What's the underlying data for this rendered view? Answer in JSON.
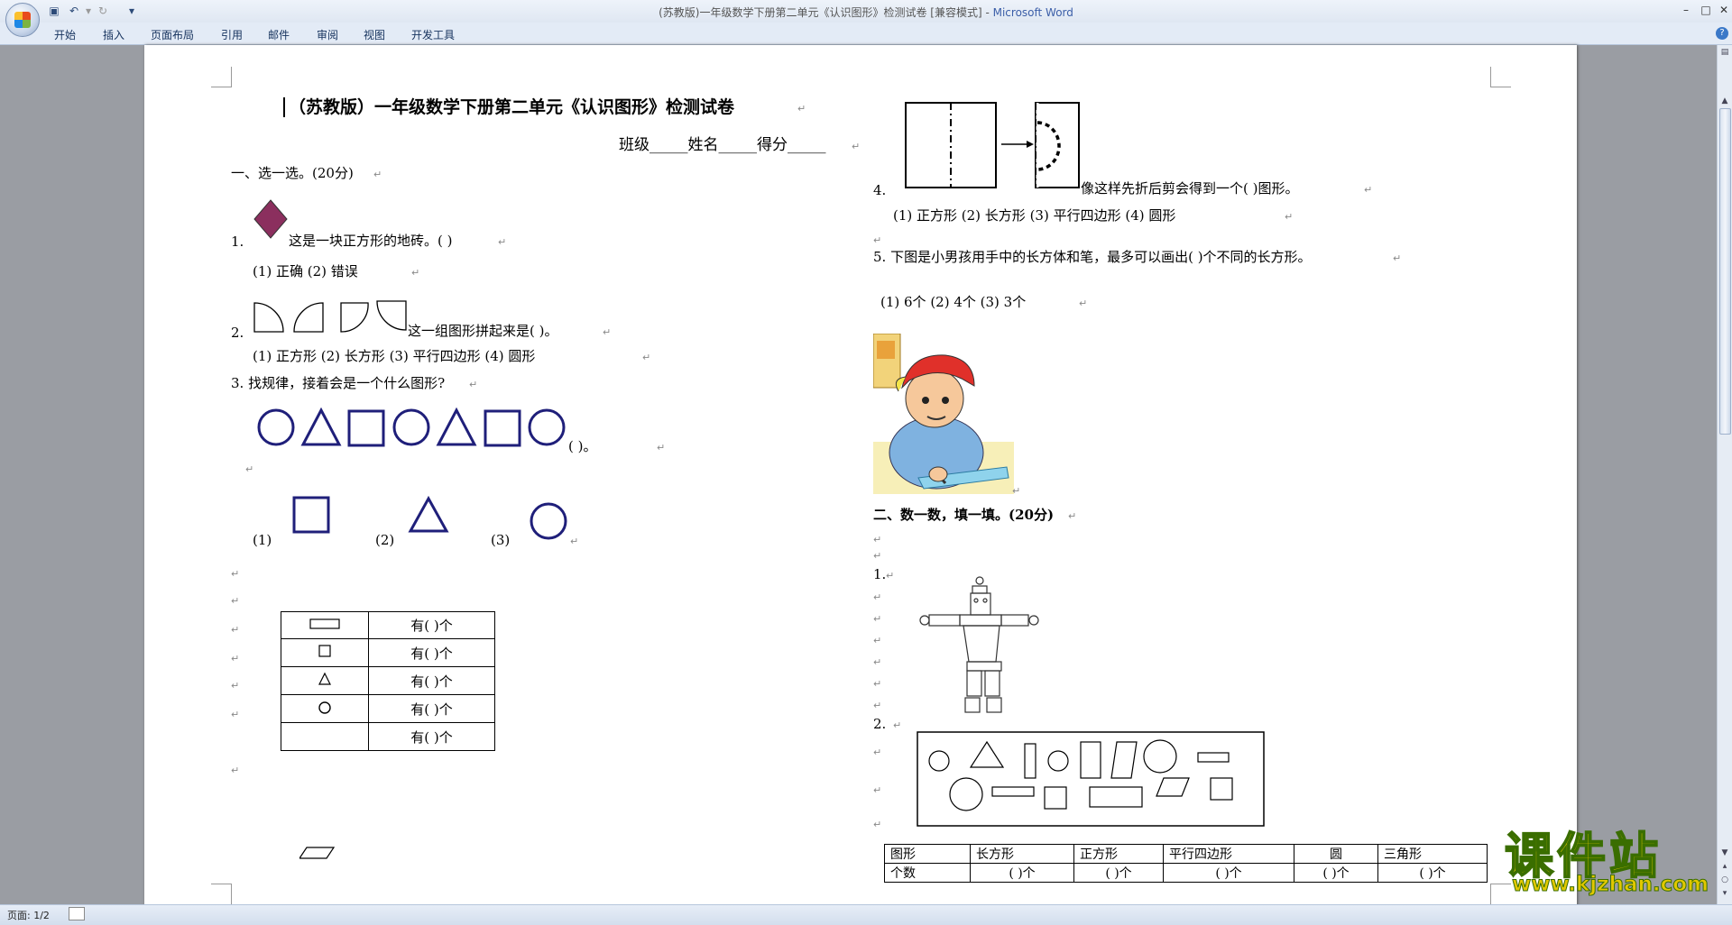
{
  "window": {
    "title_doc": "(苏教版)一年级数学下册第二单元《认识图形》检测试卷 [兼容模式]",
    "title_sep": " - ",
    "title_app": "Microsoft Word"
  },
  "ribbon": {
    "tabs": [
      "开始",
      "插入",
      "页面布局",
      "引用",
      "邮件",
      "审阅",
      "视图",
      "开发工具"
    ]
  },
  "status": {
    "page": "页面: 1/2"
  },
  "doc": {
    "title": "（苏教版）一年级数学下册第二单元《认识图形》检测试卷",
    "info": "班级_____姓名_____得分_____",
    "s1": "一、选一选。(20分)",
    "q1_num": "1.",
    "q1_text": "这是一块正方形的地砖。(    )",
    "q1_opts": "(1) 正确      (2) 错误",
    "q2_num": "2.",
    "q2_text": "这一组图形拼起来是(     )。",
    "q2_opts": "(1) 正方形      (2) 长方形      (3) 平行四边形    (4) 圆形",
    "q3_text": "3. 找规律，接着会是一个什么图形?",
    "q3_blank": "(           )。",
    "q3_o1": "(1)",
    "q3_o2": "(2)",
    "q3_o3": "(3)",
    "count_rows": [
      "有(   )个",
      "有(   )个",
      "有(   )个",
      "有(   )个",
      "有(   )个"
    ],
    "q4_num": "4.",
    "q4_text": "像这样先折后剪会得到一个(       )图形。",
    "q4_opts": "(1) 正方形      (2) 长方形      (3) 平行四边形   (4) 圆形",
    "q5_text": "5. 下图是小男孩用手中的长方体和笔，最多可以画出(       )个不同的长方形。",
    "q5_opts": "(1) 6个   (2) 4个  (3) 3个",
    "s2": "二、数一数，填一填。(20分)",
    "s2_q1": "1.",
    "s2_q2": "2.",
    "shape_table": {
      "headers": [
        "图形",
        "长方形",
        "正方形",
        "平行四边形",
        "圆",
        "三角形"
      ],
      "row_label": "个数",
      "cells": [
        "(  )个",
        "(  )个",
        "(  )个",
        "(  )个",
        "(  )个"
      ]
    }
  },
  "watermark": {
    "cn": "课件站",
    "url": "www.kjzhan.com"
  },
  "colors": {
    "diamond": "#8b2f5e",
    "shape_navy": "#1f1f7a",
    "watermark": "#e2c800"
  }
}
